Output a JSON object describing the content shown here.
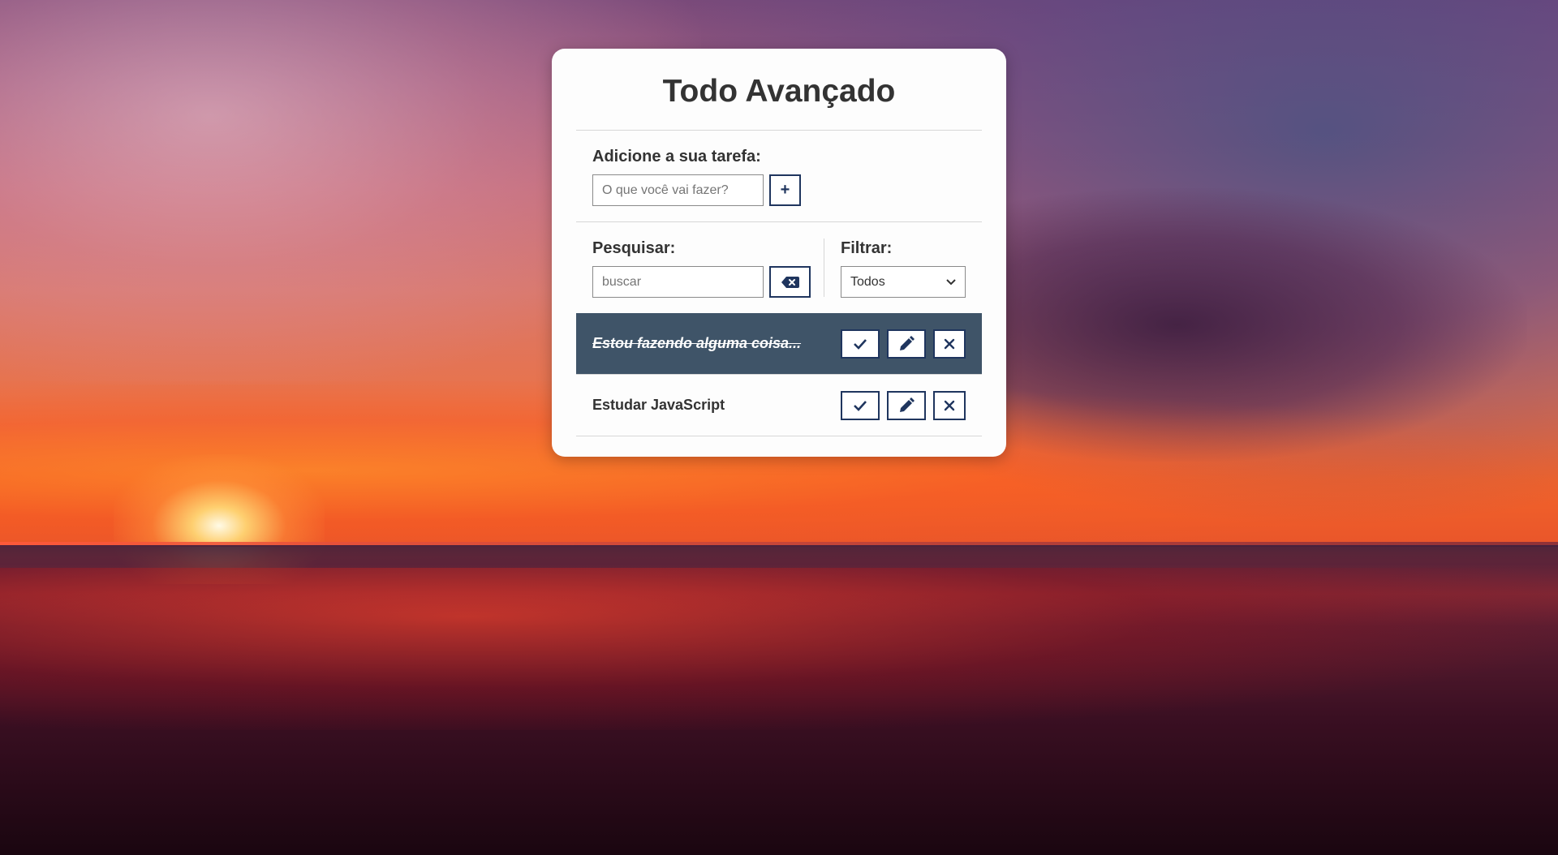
{
  "app": {
    "title": "Todo Avançado"
  },
  "add_form": {
    "label": "Adicione a sua tarefa:",
    "placeholder": "O que você vai fazer?",
    "button_label": "+"
  },
  "search": {
    "label": "Pesquisar:",
    "placeholder": "buscar",
    "erase_icon": "backspace-icon"
  },
  "filter": {
    "label": "Filtrar:",
    "selected": "Todos"
  },
  "todos": [
    {
      "text": "Estou fazendo alguma coisa...",
      "done": true
    },
    {
      "text": "Estudar JavaScript",
      "done": false
    }
  ],
  "icons": {
    "finish": "check-icon",
    "edit": "pencil-icon",
    "remove": "close-icon"
  },
  "colors": {
    "accent": "#1f355e",
    "done_row": "#3f5468",
    "card": "#fdfdfd"
  }
}
